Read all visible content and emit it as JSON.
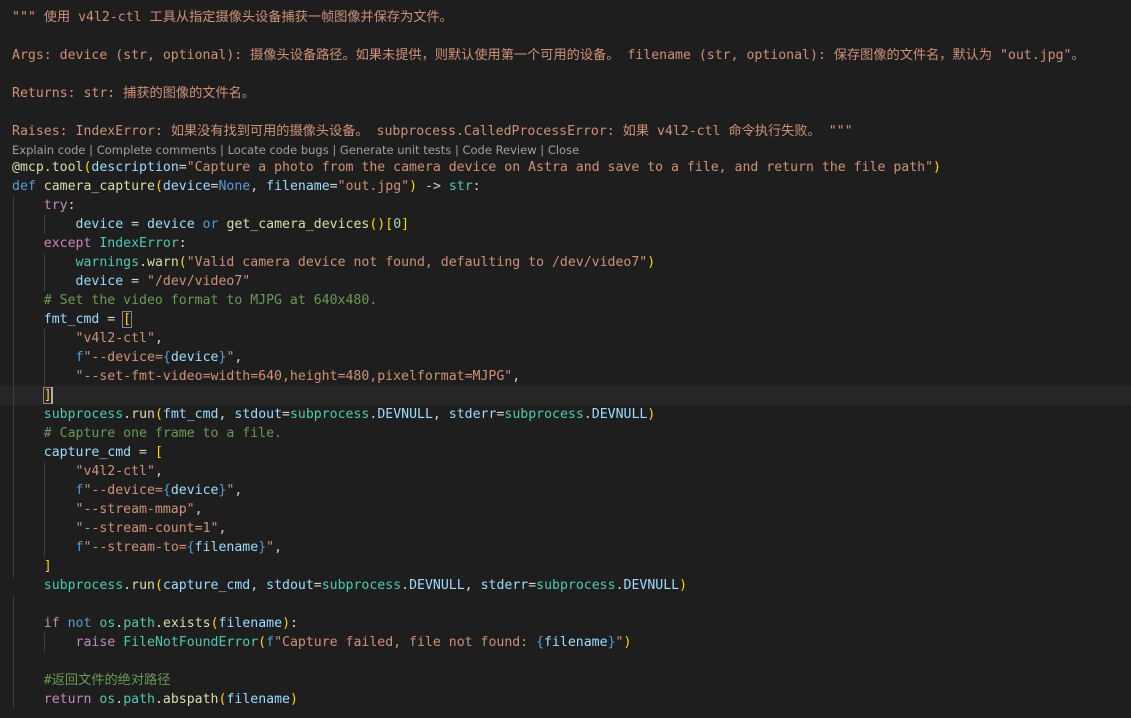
{
  "colors": {
    "background": "#1e1e1e",
    "docstring": "#ce9178",
    "keyword": "#569cd6",
    "control": "#c586c0",
    "function": "#dcdcaa",
    "variable": "#9cdcfe",
    "string": "#ce9178",
    "number": "#b5cea8",
    "class": "#4ec9b0",
    "comment": "#6a9955",
    "codelens": "#a0a0a0"
  },
  "docstring": {
    "l1": "\"\"\" 使用 v4l2-ctl 工具从指定摄像头设备捕获一帧图像并保存为文件。",
    "l3": "Args: device (str, optional): 摄像头设备路径。如果未提供，则默认使用第一个可用的设备。 filename (str, optional): 保存图像的文件名，默认为 \"out.jpg\"。",
    "l5": "Returns: str: 捕获的图像的文件名。",
    "l7": "Raises: IndexError: 如果没有找到可用的摄像头设备。 subprocess.CalledProcessError: 如果 v4l2-ctl 命令执行失败。 \"\"\""
  },
  "codelens": {
    "items": [
      "Explain code",
      "Complete comments",
      "Locate code bugs",
      "Generate unit tests",
      "Code Review",
      "Close"
    ],
    "separator": " | "
  },
  "code": {
    "decorator_name": "@mcp.tool",
    "decorator_param": "description",
    "decorator_value": "\"Capture a photo from the camera device on Astra and save to a file, and return the file path\"",
    "def_kw": "def",
    "func_name": "camera_capture",
    "param_device": "device",
    "none_kw": "None",
    "param_filename": "filename",
    "default_filename": "\"out.jpg\"",
    "arrow": "->",
    "return_type": "str",
    "try_kw": "try",
    "var_device": "device",
    "or_kw": "or",
    "get_devices_fn": "get_camera_devices",
    "zero": "0",
    "except_kw": "except",
    "index_error": "IndexError",
    "warnings_mod": "warnings",
    "warn_fn": "warn",
    "warn_msg": "\"Valid camera device not found, defaulting to /dev/video7\"",
    "dev_video7": "\"/dev/video7\"",
    "comment_fmt": "# Set the video format to MJPG at 640x480.",
    "fmt_cmd": "fmt_cmd",
    "s_v4l2": "\"v4l2-ctl\"",
    "f_prefix": "f",
    "s_device_pre": "\"--device=",
    "s_close_q": "\"",
    "s_set_fmt": "\"--set-fmt-video=width=640,height=480,pixelformat=MJPG\"",
    "subprocess": "subprocess",
    "run_fn": "run",
    "stdout_kw": "stdout",
    "stderr_kw": "stderr",
    "devnull": "DEVNULL",
    "comment_capture": "# Capture one frame to a file.",
    "capture_cmd": "capture_cmd",
    "s_stream_mmap": "\"--stream-mmap\"",
    "s_stream_count": "\"--stream-count=1\"",
    "s_stream_to_pre": "\"--stream-to=",
    "var_filename": "filename",
    "if_kw": "if",
    "not_kw": "not",
    "os_mod": "os",
    "path_attr": "path",
    "exists_fn": "exists",
    "raise_kw": "raise",
    "fnf_error": "FileNotFoundError",
    "s_capture_failed_pre": "\"Capture failed, file not found: ",
    "comment_abs": "#返回文件的绝对路径",
    "return_kw": "return",
    "abspath_fn": "abspath"
  }
}
